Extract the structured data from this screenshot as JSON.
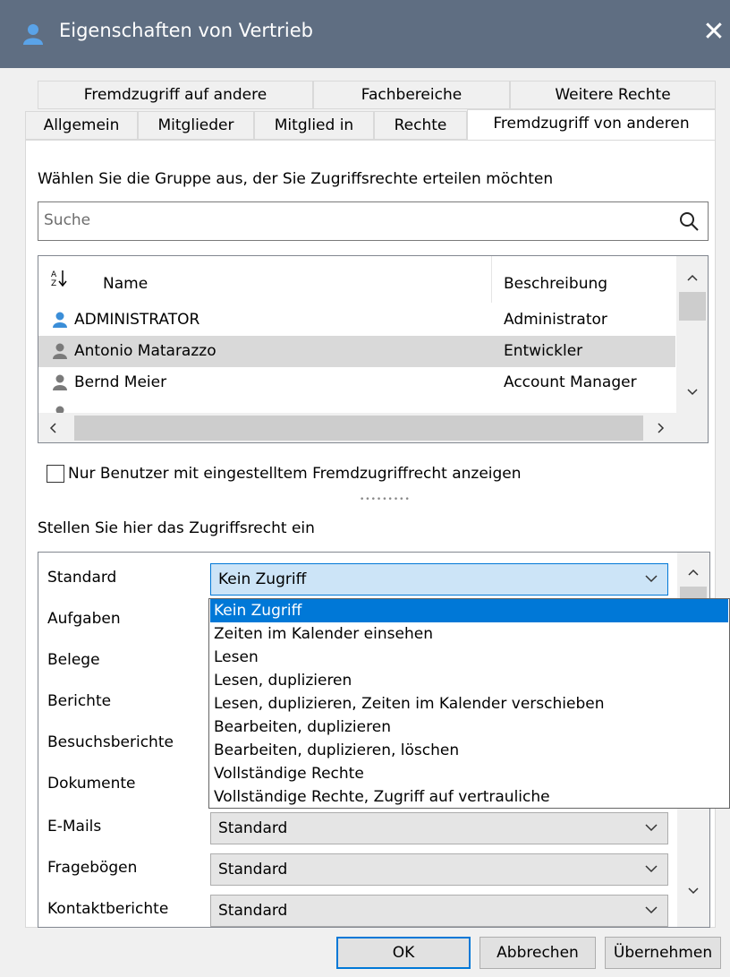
{
  "window": {
    "title": "Eigenschaften von Vertrieb",
    "icon": "user-icon",
    "close_glyph": "✕"
  },
  "tabs_row1": [
    "Fremdzugriff auf andere",
    "Fachbereiche",
    "Weitere Rechte"
  ],
  "tabs_row2": [
    "Allgemein",
    "Mitglieder",
    "Mitglied in",
    "Rechte",
    "Fremdzugriff von anderen"
  ],
  "active_tab": "Fremdzugriff von anderen",
  "group_section": {
    "prompt": "Wählen Sie die Gruppe aus, der Sie Zugriffsrechte erteilen möchten",
    "search_placeholder": "Suche",
    "columns": {
      "sort_glyph": "A↓Z",
      "name": "Name",
      "description": "Beschreibung"
    },
    "rows": [
      {
        "name": "ADMINISTRATOR",
        "description": "Administrator",
        "icon": "user-blue-icon",
        "selected": false
      },
      {
        "name": "Antonio Matarazzo",
        "description": "Entwickler",
        "icon": "user-gray-icon",
        "selected": true
      },
      {
        "name": "Bernd Meier",
        "description": "Account Manager",
        "icon": "user-gray-icon",
        "selected": false
      }
    ]
  },
  "filter_checkbox": {
    "label": "Nur Benutzer mit eingestelltem Fremdzugriffrecht anzeigen",
    "checked": false
  },
  "permission_section": {
    "heading": "Stellen Sie hier das Zugriffsrecht ein",
    "rows": [
      {
        "label": "Standard",
        "value": "Kein Zugriff"
      },
      {
        "label": "Aufgaben",
        "value": ""
      },
      {
        "label": "Belege",
        "value": ""
      },
      {
        "label": "Berichte",
        "value": ""
      },
      {
        "label": "Besuchsberichte",
        "value": ""
      },
      {
        "label": "Dokumente",
        "value": ""
      },
      {
        "label": "E-Mails",
        "value": "Standard"
      },
      {
        "label": "Fragebögen",
        "value": "Standard"
      },
      {
        "label": "Kontaktberichte",
        "value": "Standard"
      }
    ],
    "dropdown_options": [
      "Kein Zugriff",
      "Zeiten im Kalender einsehen",
      "Lesen",
      "Lesen, duplizieren",
      "Lesen, duplizieren, Zeiten im Kalender verschieben",
      "Bearbeiten, duplizieren",
      "Bearbeiten, duplizieren, löschen",
      "Vollständige Rechte",
      "Vollständige Rechte, Zugriff auf vertrauliche"
    ],
    "highlighted_option": "Kein Zugriff"
  },
  "buttons": {
    "ok": "OK",
    "cancel": "Abbrechen",
    "apply": "Übernehmen"
  },
  "colors": {
    "titlebar": "#5f6e82",
    "accent": "#0078d7",
    "selected_row": "#d9d9d9",
    "combo_open": "#cce4f7",
    "user_blue": "#3b8ed8",
    "user_gray": "#7a7a7a"
  }
}
